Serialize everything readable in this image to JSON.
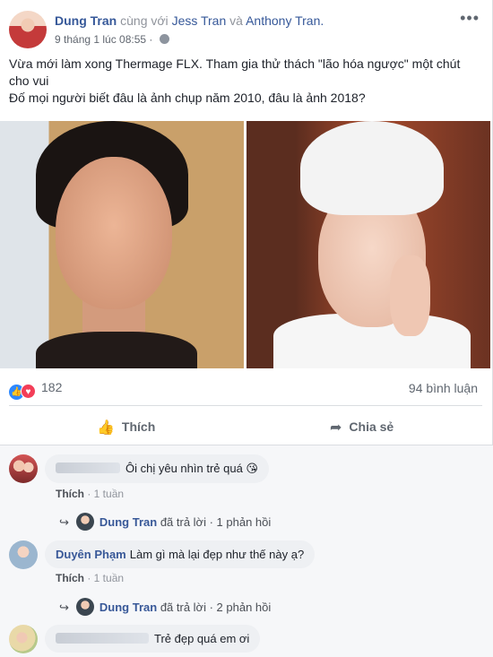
{
  "post": {
    "author": "Dung Tran",
    "with_text": "cùng với",
    "tag1": "Jess Tran",
    "and_text": "và",
    "tag2": "Anthony Tran.",
    "time": "9 tháng 1 lúc 08:55 ·",
    "more": "•••",
    "text_line1": "Vừa mới làm xong Thermage FLX. Tham gia thử thách \"lão hóa ngược\" một chút cho vui",
    "text_line2": "Đố mọi người biết đâu là ảnh chụp năm 2010, đâu là ảnh 2018?"
  },
  "stats": {
    "reaction_count": "182",
    "comments_count": "94 bình luận"
  },
  "actions": {
    "like": "Thích",
    "share": "Chia sẻ"
  },
  "comments": [
    {
      "name": "",
      "text": "Ôi chị yêu nhìn trẻ quá 😘",
      "like": "Thích",
      "time": "· 1 tuần",
      "reply_name": "Dung Tran",
      "reply_action": "đã trả lời",
      "reply_count": "· 1 phản hồi"
    },
    {
      "name": "Duyên Phạm",
      "text": "Làm gì mà lại đẹp như thế này ạ?",
      "like": "Thích",
      "time": "· 1 tuần",
      "reply_name": "Dung Tran",
      "reply_action": "đã trả lời",
      "reply_count": "· 2 phản hồi"
    },
    {
      "name": "",
      "text": "Trẻ đẹp quá em ơi"
    }
  ],
  "colors": {
    "link": "#365899",
    "like_blue": "#2d88ff",
    "love_red": "#f33e58"
  }
}
